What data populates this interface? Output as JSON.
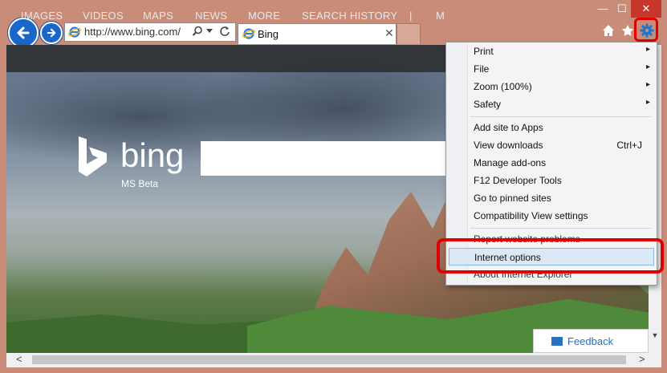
{
  "window": {
    "minimize_icon": "minimize-icon",
    "maximize_icon": "maximize-icon",
    "close_icon": "close-icon",
    "minimize_glyph": "—",
    "maximize_glyph": "☐",
    "close_glyph": "✕"
  },
  "address_bar": {
    "url": "http://www.bing.com/"
  },
  "tab": {
    "title": "Bing",
    "close_glyph": "✕"
  },
  "bing_nav": {
    "items": [
      "IMAGES",
      "VIDEOS",
      "MAPS",
      "NEWS",
      "MORE",
      "SEARCH HISTORY",
      "|",
      "M"
    ]
  },
  "bing": {
    "logo_text": "bing",
    "subtitle": "MS Beta"
  },
  "feedback": {
    "label": "Feedback"
  },
  "scroll": {
    "left_glyph": "<",
    "right_glyph": ">",
    "down_glyph": "▼"
  },
  "menu": {
    "items": [
      {
        "label": "Print",
        "submenu": true
      },
      {
        "label": "File",
        "submenu": true
      },
      {
        "label": "Zoom (100%)",
        "submenu": true
      },
      {
        "label": "Safety",
        "submenu": true
      },
      {
        "label": "Add site to Apps"
      },
      {
        "label": "View downloads",
        "shortcut": "Ctrl+J"
      },
      {
        "label": "Manage add-ons"
      },
      {
        "label": "F12 Developer Tools"
      },
      {
        "label": "Go to pinned sites"
      },
      {
        "label": "Compatibility View settings"
      },
      {
        "label": "Report website problems"
      },
      {
        "label": "Internet options",
        "highlighted": true
      },
      {
        "label": "About Internet Explorer"
      }
    ],
    "arrow_glyph": "▸"
  },
  "colors": {
    "highlight_red": "#e00000",
    "ie_blue": "#1a67c9",
    "menu_hover": "#dbe8f5"
  }
}
